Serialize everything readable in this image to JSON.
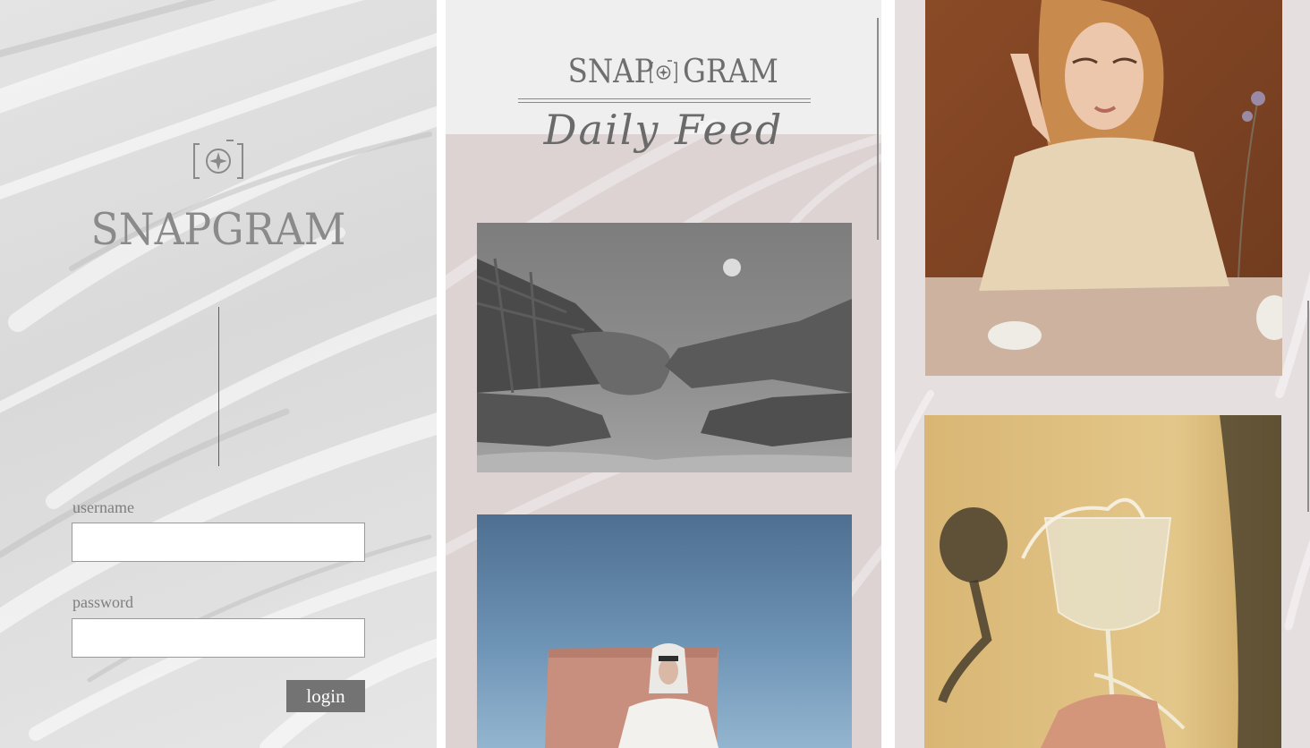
{
  "login": {
    "brand": "SNAPGRAM",
    "username_label": "username",
    "username_value": "",
    "password_label": "password",
    "password_value": "",
    "login_label": "login",
    "icons": [
      "camera-logo-icon"
    ]
  },
  "feed": {
    "brand_left": "SNAP",
    "brand_right": "GRAM",
    "subtitle": "Daily Feed",
    "posts": [
      {
        "image": "hands-under-moon-photo"
      },
      {
        "image": "hooded-figure-desert-photo"
      }
    ]
  },
  "gallery": {
    "posts": [
      {
        "image": "woman-portrait-photo"
      },
      {
        "image": "splashing-glass-photo"
      }
    ]
  },
  "colors": {
    "login_bg": "#dedede",
    "feed_header_bg": "#efefef",
    "feed_bg": "#ddd3d3",
    "gallery_bg": "#e6dfe0",
    "button_bg": "#737373",
    "text_gray": "#7e7e7e"
  }
}
